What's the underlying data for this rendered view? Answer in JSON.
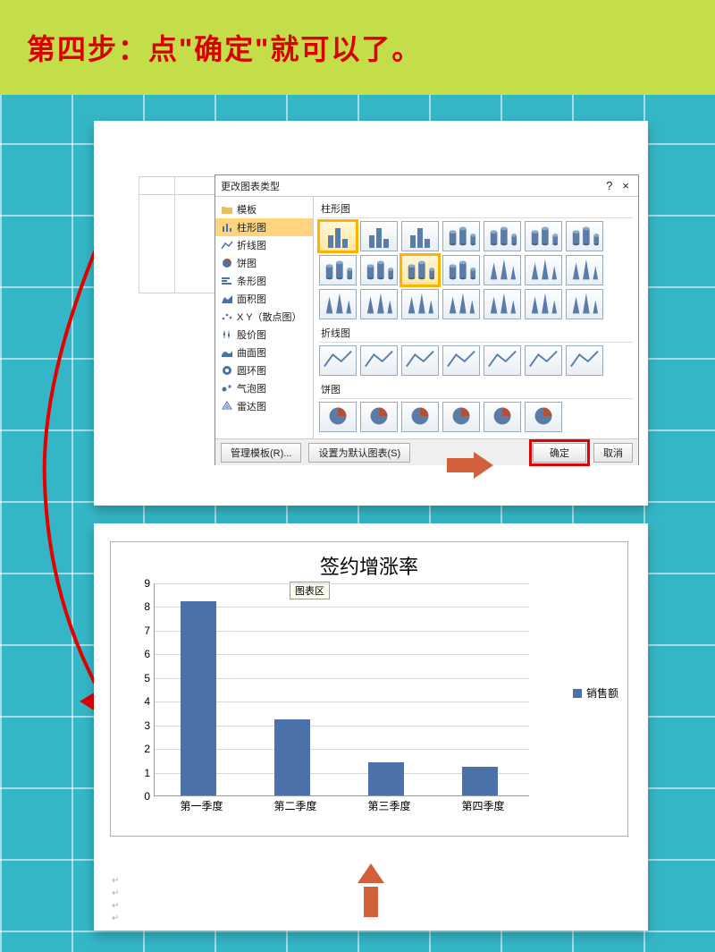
{
  "header": {
    "title": "第四步：点\"确定\"就可以了。"
  },
  "dialog": {
    "title": "更改图表类型",
    "help": "?",
    "close": "×",
    "categories": [
      {
        "icon": "folder",
        "label": "模板"
      },
      {
        "icon": "bar",
        "label": "柱形图",
        "selected": true
      },
      {
        "icon": "line",
        "label": "折线图"
      },
      {
        "icon": "pie",
        "label": "饼图"
      },
      {
        "icon": "hbar",
        "label": "条形图"
      },
      {
        "icon": "area",
        "label": "面积图"
      },
      {
        "icon": "scatter",
        "label": "X Y（散点图）"
      },
      {
        "icon": "stock",
        "label": "股价图"
      },
      {
        "icon": "surface",
        "label": "曲面图"
      },
      {
        "icon": "donut",
        "label": "圆环图"
      },
      {
        "icon": "bubble",
        "label": "气泡图"
      },
      {
        "icon": "radar",
        "label": "雷达图"
      }
    ],
    "sections": {
      "column": "柱形图",
      "line": "折线图",
      "pie": "饼图"
    },
    "buttons": {
      "manage": "管理模板(R)...",
      "set_default": "设置为默认图表(S)",
      "ok": "确定",
      "cancel": "取消"
    }
  },
  "chart_tooltip": "图表区",
  "chart_data": {
    "type": "bar",
    "title": "签约增涨率",
    "categories": [
      "第一季度",
      "第二季度",
      "第三季度",
      "第四季度"
    ],
    "series": [
      {
        "name": "销售额",
        "values": [
          8.2,
          3.2,
          1.4,
          1.2
        ]
      }
    ],
    "ylim": [
      0,
      9
    ],
    "y_ticks": [
      0,
      1,
      2,
      3,
      4,
      5,
      6,
      7,
      8,
      9
    ],
    "xlabel": "",
    "ylabel": ""
  }
}
